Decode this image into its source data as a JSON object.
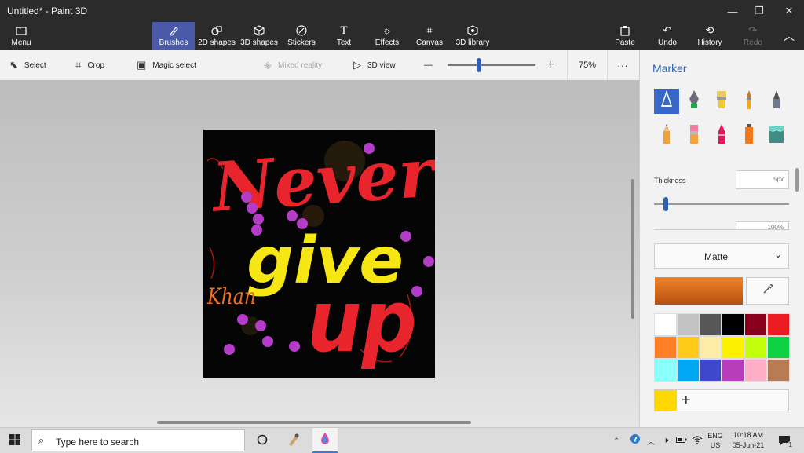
{
  "window": {
    "title": "Untitled* - Paint 3D",
    "minimize_glyph": "—",
    "maximize_glyph": "❐",
    "close_glyph": "✕"
  },
  "ribbon": {
    "menu": {
      "label": "Menu",
      "icon": "folder-icon"
    },
    "tabs": [
      {
        "label": "Brushes",
        "icon": "brush-icon",
        "active": true
      },
      {
        "label": "2D shapes",
        "icon": "2d-shapes-icon"
      },
      {
        "label": "3D shapes",
        "icon": "cube-icon"
      },
      {
        "label": "Stickers",
        "icon": "sticker-icon"
      },
      {
        "label": "Text",
        "icon": "text-icon"
      },
      {
        "label": "Effects",
        "icon": "sun-icon"
      },
      {
        "label": "Canvas",
        "icon": "canvas-icon"
      },
      {
        "label": "3D library",
        "icon": "library-icon"
      }
    ],
    "right": [
      {
        "label": "Paste",
        "icon": "clipboard-icon"
      },
      {
        "label": "Undo",
        "icon": "undo-icon"
      },
      {
        "label": "History",
        "icon": "history-icon"
      },
      {
        "label": "Redo",
        "icon": "redo-icon",
        "disabled": true
      }
    ],
    "collapse_glyph": "︿"
  },
  "toolbar": {
    "select": "Select",
    "crop": "Crop",
    "magic_select": "Magic select",
    "mixed_reality": "Mixed reality",
    "view_3d": "3D view",
    "zoom_minus": "—",
    "zoom_plus": "+",
    "zoom": "75%",
    "zoom_value": 0.75,
    "more": "···"
  },
  "canvas": {
    "texts": [
      {
        "text": "Never",
        "color": "#e8242c"
      },
      {
        "text": "give",
        "color": "#f6e614"
      },
      {
        "text": "up",
        "color": "#e8242c"
      },
      {
        "text": "Khan",
        "color": "#f06e1e"
      }
    ],
    "dot_color": "#b43cc8"
  },
  "panel": {
    "title": "Marker",
    "tools": [
      {
        "name": "calligraphy-pen-icon",
        "selected": true
      },
      {
        "name": "ink-pen-icon"
      },
      {
        "name": "oil-brush-icon"
      },
      {
        "name": "watercolor-icon"
      },
      {
        "name": "pixel-pen-icon"
      },
      {
        "name": "pencil-icon"
      },
      {
        "name": "eraser-icon"
      },
      {
        "name": "crayon-icon"
      },
      {
        "name": "spray-can-icon"
      },
      {
        "name": "fill-bucket-icon"
      }
    ],
    "thickness_label": "Thickness",
    "thickness_value": "5px",
    "thickness_slider": 0.05,
    "opacity_partial": "100%",
    "finish": "Matte",
    "current_color": "#e8782a",
    "palette": [
      "#ffffff",
      "#c3c3c3",
      "#585858",
      "#000000",
      "#88001b",
      "#ec1c24",
      "#ff7f27",
      "#ffca18",
      "#fdeca6",
      "#fff200",
      "#c4ff0e",
      "#0ed145",
      "#8cfffb",
      "#00a8f3",
      "#3f48cc",
      "#b83dba",
      "#ffaec8",
      "#b97a56"
    ],
    "custom_color": "#ffd800",
    "add_glyph": "+"
  },
  "taskbar": {
    "search_placeholder": "Type here to search",
    "language": "ENG",
    "region": "US",
    "time": "10:18 AM",
    "date": "05-Jun-21",
    "notifications": "1"
  }
}
